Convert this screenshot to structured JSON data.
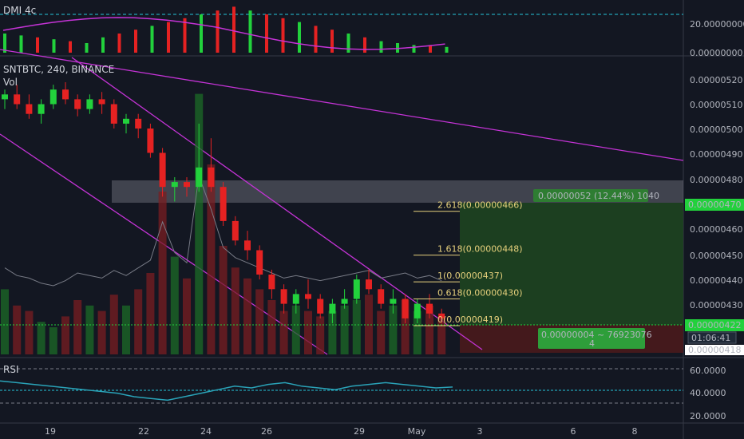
{
  "panels": {
    "dmi": {
      "title": "DMI 4c",
      "ticks": [
        "20.00000000",
        "0.00000000"
      ]
    },
    "main": {
      "symbol_line": "SNTBTC, 240, BINANCE",
      "vol_label": "Vol"
    },
    "rsi": {
      "title": "RSI",
      "ticks": [
        "60.0000",
        "40.0000",
        "20.0000"
      ]
    }
  },
  "price_axis": {
    "ticks": [
      "0.00000520",
      "0.00000510",
      "0.00000500",
      "0.00000490",
      "0.00000480",
      "0.00000460",
      "0.00000450",
      "0.00000440",
      "0.00000430"
    ],
    "current_price": "0.00000470",
    "last_price": "0.00000422",
    "countdown": "01:06:41",
    "low_price": "0.00000418"
  },
  "time_axis": {
    "ticks": [
      "19",
      "22",
      "24",
      "26",
      "29",
      "May",
      "3",
      "6",
      "8"
    ]
  },
  "fib_levels": [
    {
      "label": "2.618(0.00000466)",
      "value": 4.66
    },
    {
      "label": "1.618(0.00000448)",
      "value": 4.48
    },
    {
      "label": "1(0.00000437)",
      "value": 4.37
    },
    {
      "label": "0.618(0.00000430)",
      "value": 4.3
    },
    {
      "label": "0(0.00000419)",
      "value": 4.19
    }
  ],
  "position_tool": {
    "profit_label": "0.00000052 (12.44%) 1040",
    "risk_label_line1": "0.00000004 ~ 76923076",
    "risk_label_line2": "4"
  },
  "colors": {
    "bg": "#131722",
    "up": "#26a69a",
    "up_bright": "#22d13c",
    "down": "#ef5350",
    "down_bright": "#e52222",
    "magenta": "#c433d6",
    "fib": "#e6d07c",
    "teal_line": "#26c6da",
    "profit_zone": "#1e4620",
    "loss_zone": "#4a1a1c"
  },
  "chart_data": {
    "type": "candlestick",
    "title": "SNTBTC, 240, BINANCE",
    "x_ticks": [
      "19",
      "22",
      "24",
      "26",
      "29",
      "May",
      "3",
      "6",
      "8"
    ],
    "ylim": [
      4.18,
      5.26
    ],
    "y_unit": "x1e-8 BTC",
    "ohlc_approx": [
      [
        5.12,
        5.16,
        5.08,
        5.14
      ],
      [
        5.14,
        5.18,
        5.08,
        5.1
      ],
      [
        5.1,
        5.14,
        5.04,
        5.06
      ],
      [
        5.06,
        5.12,
        5.02,
        5.1
      ],
      [
        5.1,
        5.18,
        5.08,
        5.16
      ],
      [
        5.16,
        5.19,
        5.1,
        5.12
      ],
      [
        5.12,
        5.14,
        5.05,
        5.08
      ],
      [
        5.08,
        5.14,
        5.06,
        5.12
      ],
      [
        5.12,
        5.15,
        5.06,
        5.1
      ],
      [
        5.1,
        5.12,
        5.0,
        5.02
      ],
      [
        5.02,
        5.06,
        4.98,
        5.04
      ],
      [
        5.04,
        5.06,
        4.96,
        5.0
      ],
      [
        5.0,
        5.02,
        4.88,
        4.9
      ],
      [
        4.9,
        4.92,
        4.72,
        4.76
      ],
      [
        4.76,
        4.8,
        4.7,
        4.78
      ],
      [
        4.78,
        4.8,
        4.72,
        4.76
      ],
      [
        4.76,
        5.02,
        4.74,
        4.84
      ],
      [
        4.84,
        4.96,
        4.74,
        4.76
      ],
      [
        4.76,
        4.78,
        4.6,
        4.62
      ],
      [
        4.62,
        4.64,
        4.52,
        4.54
      ],
      [
        4.54,
        4.58,
        4.46,
        4.5
      ],
      [
        4.5,
        4.52,
        4.38,
        4.4
      ],
      [
        4.4,
        4.42,
        4.3,
        4.34
      ],
      [
        4.34,
        4.36,
        4.24,
        4.28
      ],
      [
        4.28,
        4.34,
        4.24,
        4.32
      ],
      [
        4.32,
        4.38,
        4.26,
        4.3
      ],
      [
        4.3,
        4.32,
        4.22,
        4.24
      ],
      [
        4.24,
        4.3,
        4.2,
        4.28
      ],
      [
        4.28,
        4.34,
        4.26,
        4.3
      ],
      [
        4.3,
        4.4,
        4.28,
        4.38
      ],
      [
        4.38,
        4.42,
        4.32,
        4.34
      ],
      [
        4.34,
        4.36,
        4.26,
        4.28
      ],
      [
        4.28,
        4.34,
        4.24,
        4.3
      ],
      [
        4.3,
        4.32,
        4.2,
        4.22
      ],
      [
        4.22,
        4.3,
        4.2,
        4.28
      ],
      [
        4.28,
        4.32,
        4.22,
        4.24
      ],
      [
        4.24,
        4.26,
        4.2,
        4.22
      ]
    ],
    "volume_approx": [
      12,
      9,
      8,
      6,
      5,
      7,
      10,
      9,
      8,
      11,
      9,
      12,
      15,
      30,
      18,
      14,
      48,
      35,
      20,
      16,
      14,
      12,
      10,
      8,
      9,
      8,
      7,
      8,
      9,
      10,
      11,
      8,
      9,
      10,
      8,
      9,
      7
    ],
    "rsi_approx": [
      48,
      46,
      44,
      42,
      40,
      38,
      36,
      34,
      30,
      28,
      26,
      30,
      34,
      38,
      42,
      40,
      44,
      46,
      42,
      40,
      38,
      42,
      44,
      46,
      44,
      42,
      40,
      41
    ],
    "dmi_approx": [
      10,
      9,
      8,
      7,
      6,
      5,
      8,
      10,
      12,
      14,
      16,
      18,
      20,
      22,
      24,
      22,
      20,
      18,
      16,
      14,
      12,
      10,
      8,
      6,
      5,
      4,
      4,
      3
    ]
  }
}
